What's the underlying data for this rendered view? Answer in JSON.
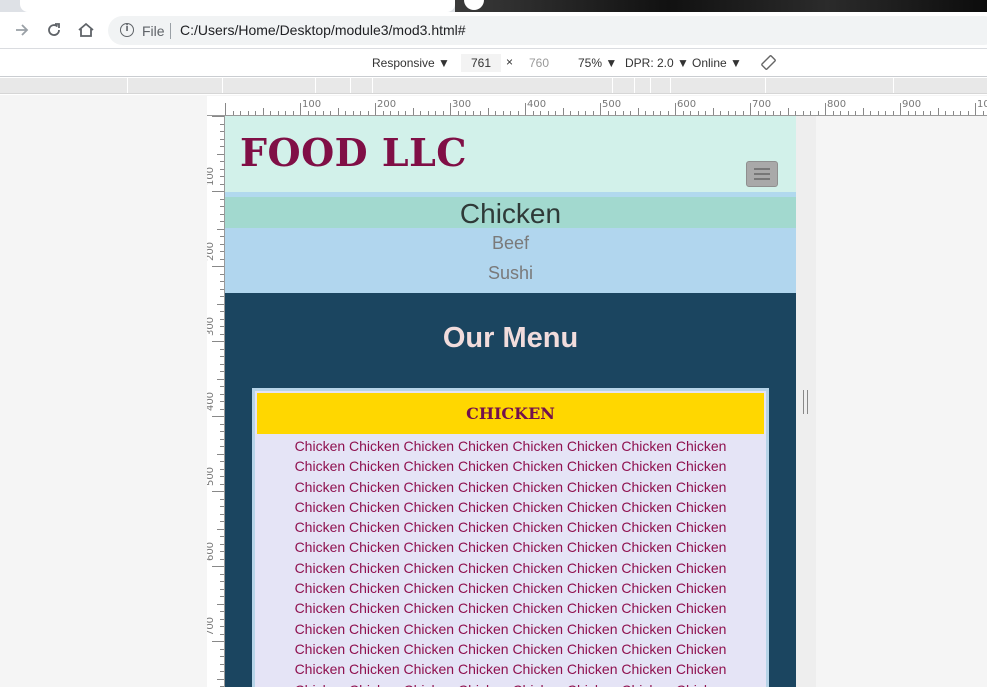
{
  "browser": {
    "scheme_label": "File",
    "url": "C:/Users/Home/Desktop/module3/mod3.html#"
  },
  "device_toolbar": {
    "mode": "Responsive ▼",
    "width": "761",
    "times": "×",
    "height": "760",
    "zoom": "75% ▼",
    "dpr": "DPR: 2.0 ▼",
    "network": "Online ▼"
  },
  "ruler": {
    "top_labels": [
      "100",
      "200",
      "300",
      "400",
      "500",
      "600",
      "700",
      "800",
      "900",
      "10"
    ],
    "left_labels": [
      "100",
      "200",
      "300",
      "400",
      "500",
      "600",
      "700"
    ]
  },
  "site": {
    "logo": "FOOD LLC",
    "nav": {
      "active": "Chicken",
      "links": [
        "Beef",
        "Sushi"
      ]
    },
    "menu_title": "Our Menu",
    "card": {
      "heading": "CHICKEN",
      "line": "Chicken Chicken Chicken Chicken Chicken Chicken Chicken Chicken",
      "line_count": 13
    }
  },
  "colors": {
    "header_bg": "#d2f1ea",
    "logo": "#800f46",
    "nav_active_bg": "#a2d9cf",
    "nav_bg": "#b1d6ee",
    "page_bg": "#1b4560",
    "card_bg": "#e5e4f6",
    "card_head_bg": "#ffd700"
  }
}
